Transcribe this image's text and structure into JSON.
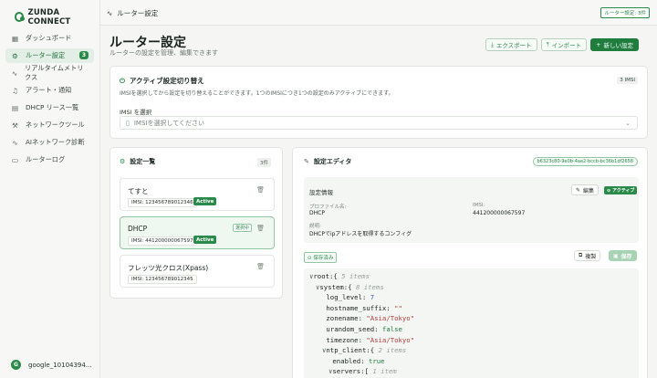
{
  "app": {
    "logo_text": "ZUNDA CONNECT"
  },
  "sidebar": {
    "items": [
      {
        "label": "ダッシュボード",
        "icon": "grid-icon",
        "glyph": "▦"
      },
      {
        "label": "ルーター設定",
        "icon": "settings-icon",
        "glyph": "⚙",
        "badge": "3"
      },
      {
        "label": "リアルタイムメトリクス",
        "icon": "activity-icon",
        "glyph": "∿"
      },
      {
        "label": "アラート・通知",
        "icon": "bell-icon",
        "glyph": "♫"
      },
      {
        "label": "DHCP リース一覧",
        "icon": "server-icon",
        "glyph": "▤"
      },
      {
        "label": "ネットワークツール",
        "icon": "network-icon",
        "glyph": "⚒"
      },
      {
        "label": "AIネットワーク診断",
        "icon": "ai-pulse-icon",
        "glyph": "∿"
      },
      {
        "label": "ルーターログ",
        "icon": "document-icon",
        "glyph": "▭"
      }
    ],
    "user": {
      "avatar": "G",
      "name": "google_10104394..."
    }
  },
  "topbar": {
    "title": "ルーター設定",
    "badge": "ルーター設定: 3件"
  },
  "header": {
    "title": "ルーター設定",
    "subtitle": "ルーターの設定を管理、編集できます",
    "export_label": "エクスポート",
    "import_label": "インポート",
    "new_label": "新しい設定"
  },
  "active_config": {
    "title": "アクティブ設定切り替え",
    "description": "IMSIを選択してから設定を切り替えることができます。1つのIMSIにつき1つの設定のみアクティブにできます。",
    "badge": "3 IMSI",
    "select_label": "IMSI を選択",
    "select_placeholder": "IMSIを選択してください"
  },
  "config_list": {
    "title": "設定一覧",
    "count": "3件",
    "items": [
      {
        "name": "てすと",
        "imsi": "IMSI: 123456789012346",
        "active": "Active",
        "selected": ""
      },
      {
        "name": "DHCP",
        "imsi": "IMSI: 441200000067597",
        "active": "Active",
        "selected": "選択中"
      },
      {
        "name": "フレッツ光クロス(Xpass)",
        "imsi": "IMSI: 123456789012345",
        "active": "",
        "selected": ""
      }
    ]
  },
  "editor": {
    "title": "設定エディタ",
    "uuid": "b6323c80-9e0b-4ae2-bccb-bc36b1df2658",
    "info_title": "設定情報",
    "edit_label": "編集",
    "active_label": "アクティブ",
    "profile_label": "プロファイル名:",
    "profile_value": "DHCP",
    "imsi_label": "IMSI:",
    "imsi_value": "441200000067597",
    "desc_label": "説明:",
    "desc_value": "DHCPでipアドレスを取得するコンフィグ",
    "saved_label": "保存済み",
    "copy_label": "複製",
    "save_label": "保存",
    "tree": [
      {
        "indent": 0,
        "arrow": "∨",
        "key": "root",
        "suffix": ":{",
        "meta": "5 items"
      },
      {
        "indent": 1,
        "arrow": "∨",
        "key": "system",
        "suffix": ":{",
        "meta": "8 items"
      },
      {
        "indent": 2,
        "arrow": "",
        "key": "log_level",
        "suffix": ": ",
        "value": "7",
        "vtype": "n"
      },
      {
        "indent": 2,
        "arrow": "",
        "key": "hostname_suffix",
        "suffix": ": ",
        "value": "\"\"",
        "vtype": "s"
      },
      {
        "indent": 2,
        "arrow": "",
        "key": "zonename",
        "suffix": ": ",
        "value": "\"Asia/Tokyo\"",
        "vtype": "s"
      },
      {
        "indent": 2,
        "arrow": "",
        "key": "urandom_seed",
        "suffix": ": ",
        "value": "false",
        "vtype": "bl"
      },
      {
        "indent": 2,
        "arrow": "",
        "key": "timezone",
        "suffix": ": ",
        "value": "\"Asia/Tokyo\"",
        "vtype": "s"
      },
      {
        "indent": 2,
        "arrow": "∨",
        "key": "ntp_client",
        "suffix": ":{",
        "meta": "2 items"
      },
      {
        "indent": 3,
        "arrow": "",
        "key": "enabled",
        "suffix": ": ",
        "value": "true",
        "vtype": "bl"
      },
      {
        "indent": 3,
        "arrow": "∨",
        "key": "servers",
        "suffix": ":[",
        "meta": "1 item"
      }
    ]
  }
}
